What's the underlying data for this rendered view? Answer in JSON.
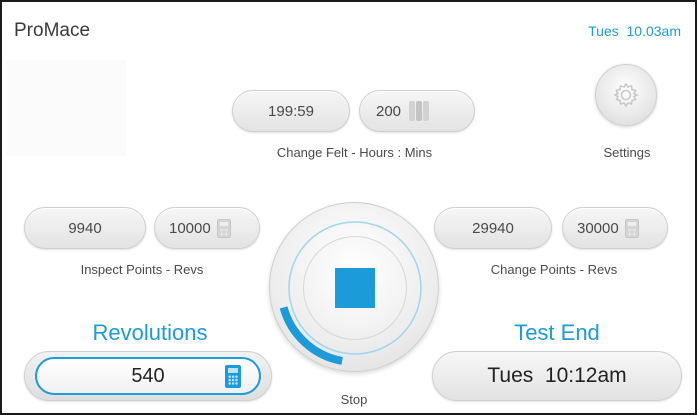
{
  "header": {
    "app_title": "ProMace",
    "clock": "Tues  10.03am"
  },
  "change_felt": {
    "hours_mins": "199:59",
    "setpoint": "200",
    "label": "Change Felt - Hours : Mins"
  },
  "settings": {
    "label": "Settings"
  },
  "inspect_points": {
    "current": "9940",
    "setpoint": "10000",
    "label": "Inspect Points - Revs"
  },
  "change_points": {
    "current": "29940",
    "setpoint": "30000",
    "label": "Change Points - Revs"
  },
  "stop_button": {
    "label": "Stop",
    "progress_fraction": 0.18
  },
  "revolutions": {
    "title": "Revolutions",
    "value": "540"
  },
  "test_end": {
    "title": "Test End",
    "value": "Tues  10:12am"
  },
  "colors": {
    "accent": "#1b9bd7",
    "text": "#333333",
    "pill": "#e8e8e8"
  }
}
